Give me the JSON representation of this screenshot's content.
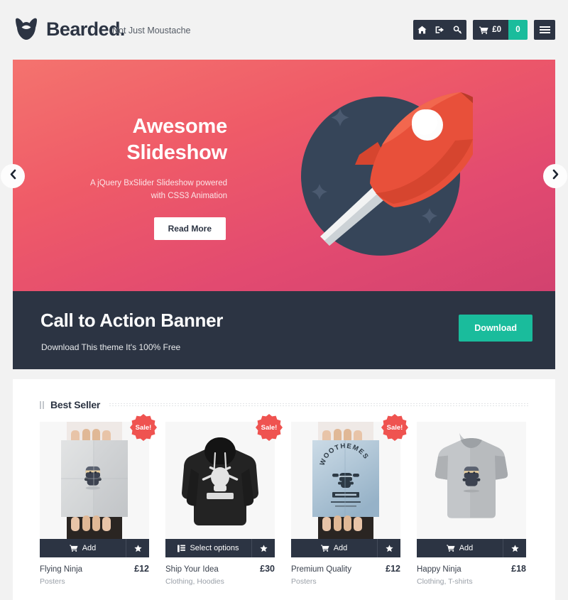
{
  "header": {
    "logo_icon": "beard-icon",
    "logo_text": "Bearded.",
    "tagline": "Not Just Moustache",
    "icons": [
      {
        "name": "home-icon",
        "label": "Home"
      },
      {
        "name": "sign-in-icon",
        "label": "Login"
      },
      {
        "name": "search-key-icon",
        "label": "Search"
      }
    ],
    "cart": {
      "icon": "cart-icon",
      "amount": "£0",
      "count": "0",
      "accent": "#1abc9c"
    },
    "menu_icon": "hamburger-menu-icon"
  },
  "slider": {
    "title_line1": "Awesome",
    "title_line2": "Slideshow",
    "subtitle_line1": "A jQuery BxSlider Slideshow powered",
    "subtitle_line2": "with CSS3 Animation",
    "button_label": "Read More",
    "prev_icon": "chevron-left-icon",
    "next_icon": "chevron-right-icon",
    "illustration": "rocket-illustration",
    "gradient_from": "#f4736e",
    "gradient_to": "#d2426f"
  },
  "cta": {
    "title": "Call to Action Banner",
    "subtitle": "Download This theme It's 100% Free",
    "button_label": "Download",
    "background": "#2c3443",
    "button_color": "#1abc9c"
  },
  "best_seller": {
    "title": "Best Seller",
    "products": [
      {
        "name": "Flying Ninja",
        "category": "Posters",
        "price": "£12",
        "action_label": "Add",
        "action_icon": "cart-icon",
        "fav_icon": "star-icon",
        "sale": true,
        "sale_label": "Sale!",
        "image": "poster-flying-ninja"
      },
      {
        "name": "Ship Your Idea",
        "category": "Clothing, Hoodies",
        "price": "£30",
        "action_label": "Select options",
        "action_icon": "list-icon",
        "fav_icon": "star-icon",
        "sale": true,
        "sale_label": "Sale!",
        "image": "black-hoodie-skull"
      },
      {
        "name": "Premium Quality",
        "category": "Posters",
        "price": "£12",
        "action_label": "Add",
        "action_icon": "cart-icon",
        "fav_icon": "star-icon",
        "sale": true,
        "sale_label": "Sale!",
        "image": "poster-woothemes"
      },
      {
        "name": "Happy Ninja",
        "category": "Clothing, T-shirts",
        "price": "£18",
        "action_label": "Add",
        "action_icon": "cart-icon",
        "fav_icon": "star-icon",
        "sale": false,
        "sale_label": "",
        "image": "grey-tshirt-ninja"
      }
    ]
  }
}
